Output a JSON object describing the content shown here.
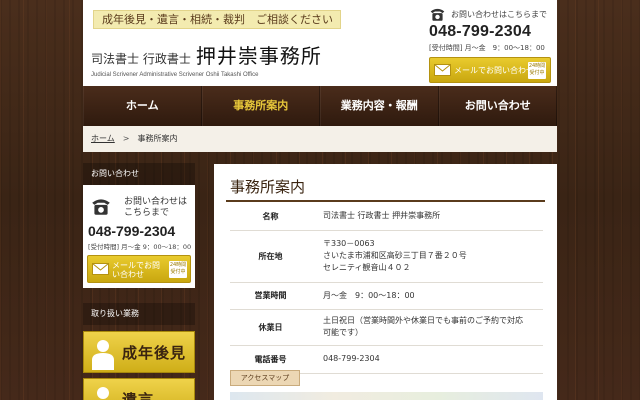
{
  "header": {
    "catchphrase": "成年後見・遺言・相続・裁判　ご相談ください",
    "title_small": "司法書士 行政書士",
    "title_big": "押井崇事務所",
    "title_en": "Judicial Scrivener Administrative Scrivener Oshii Takashi  Office",
    "contact": {
      "label": "お問い合わせはこちらまで",
      "tel": "048-799-2304",
      "hours": "[受付時間] 月～金　9：00～18：00",
      "mail_label": "メールでお問い合わせ",
      "badge": "24時間受付中"
    }
  },
  "nav": {
    "items": [
      {
        "label": "ホーム"
      },
      {
        "label": "事務所案内"
      },
      {
        "label": "業務内容・報酬"
      },
      {
        "label": "お問い合わせ"
      }
    ],
    "active_index": 1
  },
  "breadcrumb": {
    "home": "ホーム",
    "separator": ">",
    "current": "事務所案内"
  },
  "sidebar": {
    "contact_head": "お問い合わせ",
    "contact_label": "お問い合わせはこちらまで",
    "tel": "048-799-2304",
    "hours": "[受付時間] 月～金 9：00～18：00",
    "mail_label": "メールでお問い合わせ",
    "badge": "24時間受付中",
    "services_head": "取り扱い業務",
    "services": [
      {
        "label": "成年後見"
      },
      {
        "label": "遺言"
      }
    ]
  },
  "main": {
    "title": "事務所案内",
    "rows": [
      {
        "key": "名称",
        "value": "司法書士 行政書士 押井崇事務所"
      },
      {
        "key": "所在地",
        "value_lines": [
          "〒330－0063",
          "さいたま市浦和区高砂三丁目７番２０号",
          "セレニティ観音山４０２"
        ]
      },
      {
        "key": "営業時間",
        "value": "月～金　9：00～18：00"
      },
      {
        "key": "休業日",
        "value_lines": [
          "土日祝日（営業時間外や休業日でも事前のご予約で対応",
          "可能です）"
        ]
      },
      {
        "key": "電話番号",
        "value": "048-799-2304"
      }
    ],
    "access_button": "アクセスマップ"
  },
  "colors": {
    "accent_gold": "#e7c73a",
    "brown": "#3a2410"
  }
}
